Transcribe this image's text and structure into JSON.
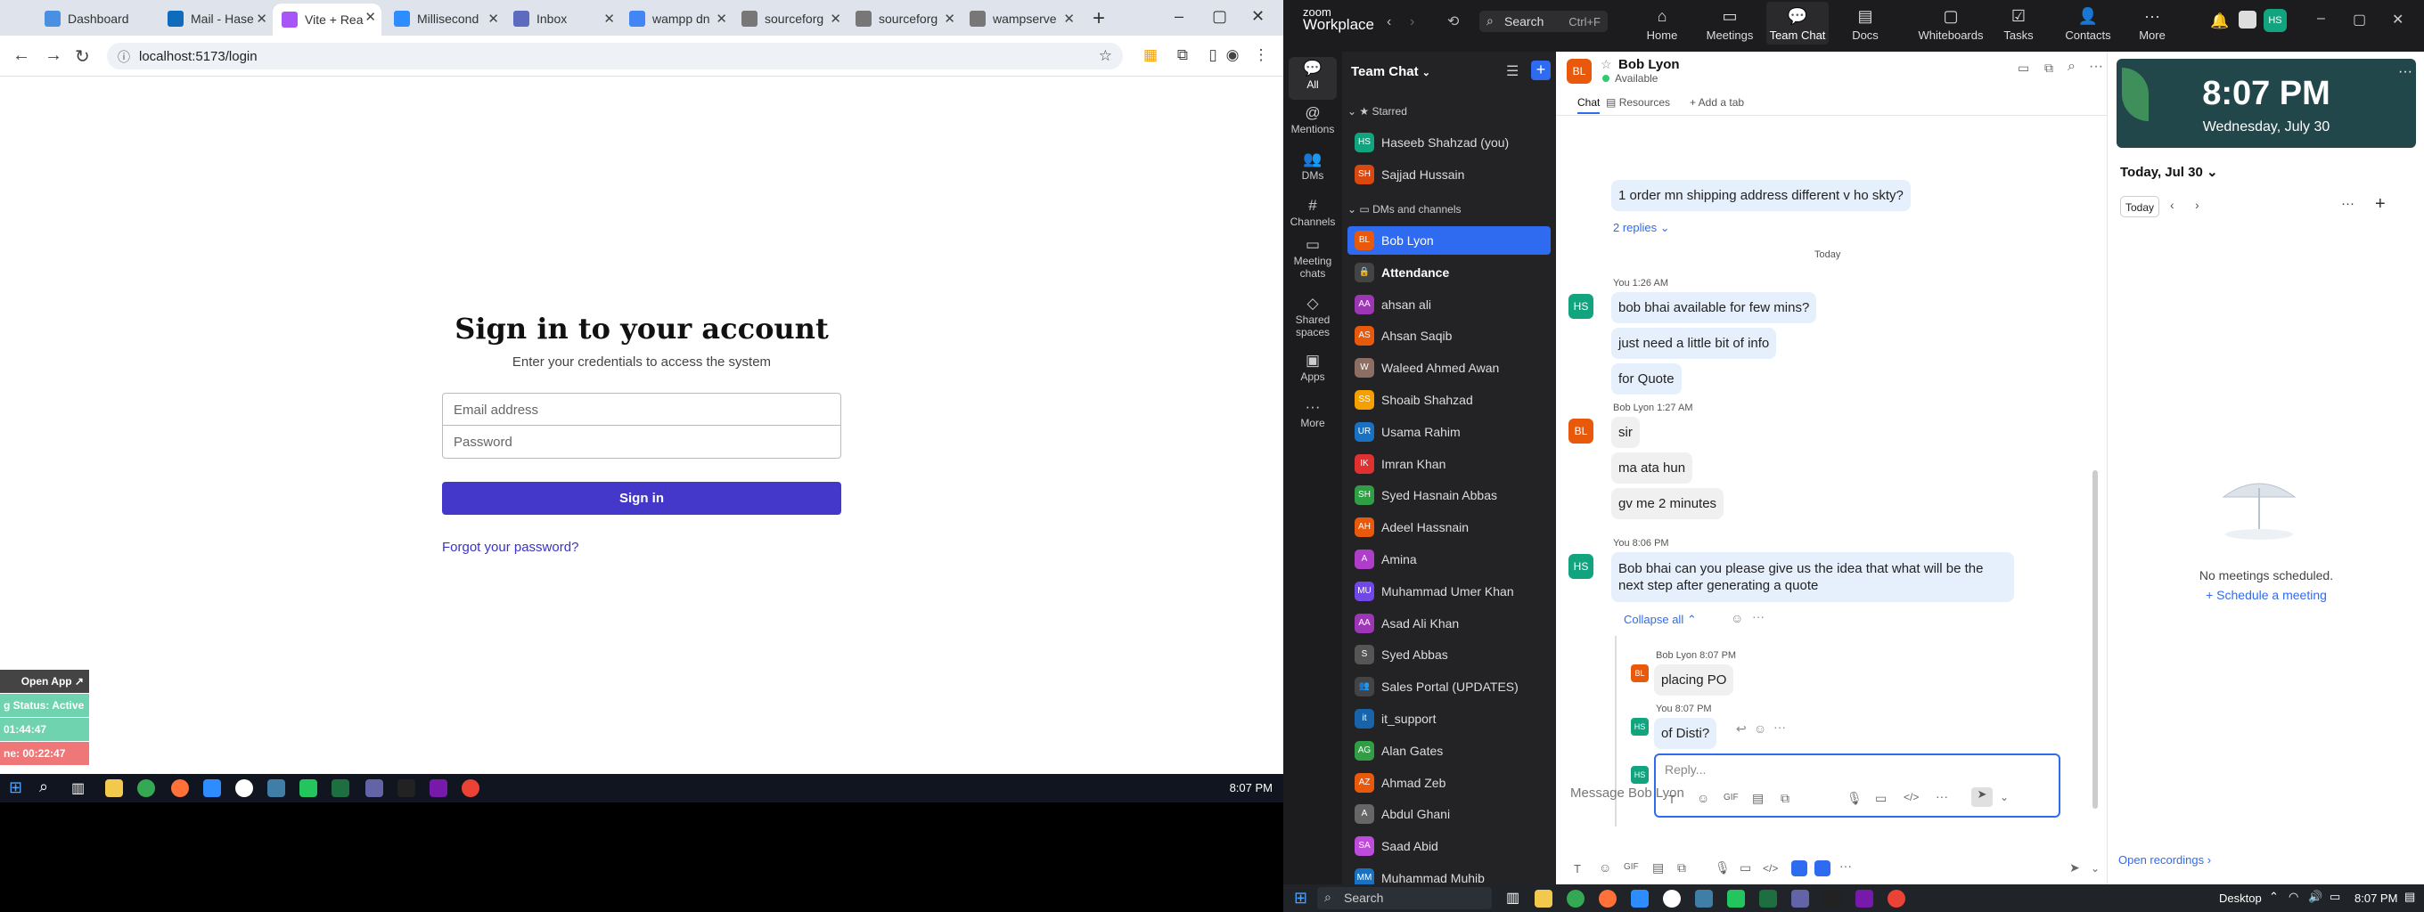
{
  "browser": {
    "tabs": [
      {
        "label": "Dashboard",
        "color": "#4a90e2"
      },
      {
        "label": "Mail - Hase",
        "color": "#0f6cbd"
      },
      {
        "label": "Vite + Rea",
        "color": "#a855f7",
        "active": true
      },
      {
        "label": "Millisecond",
        "color": "#2d8cff"
      },
      {
        "label": "Inbox",
        "color": "#5c6bc0"
      },
      {
        "label": "wampp dn",
        "color": "#4285f4"
      },
      {
        "label": "sourceforg",
        "color": "#777777"
      },
      {
        "label": "sourceforg",
        "color": "#777777"
      },
      {
        "label": "wampserve",
        "color": "#777777"
      }
    ],
    "url": "localhost:5173/login",
    "window_controls": {
      "minimize": "–",
      "maximize": "▢",
      "close": "✕"
    }
  },
  "login": {
    "title": "Sign in to your account",
    "subtitle": "Enter your credentials to access the system",
    "email_placeholder": "Email address",
    "password_placeholder": "Password",
    "submit_label": "Sign in",
    "forgot_label": "Forgot your password?"
  },
  "widget": {
    "open_app": "Open App ↗",
    "status": "g Status: Active",
    "timer1": "01:44:47",
    "timer2": "ne: 00:22:47"
  },
  "taskbar_left": {
    "time": "8:07 PM"
  },
  "zoom": {
    "logo_line1": "zoom",
    "logo_line2": "Workplace",
    "search_label": "Search",
    "search_shortcut": "Ctrl+F",
    "nav": [
      {
        "label": "Home",
        "icon": "⌂"
      },
      {
        "label": "Meetings",
        "icon": "▭"
      },
      {
        "label": "Team Chat",
        "icon": "💬",
        "active": true
      },
      {
        "label": "Docs",
        "icon": "▤"
      },
      {
        "label": "Whiteboards",
        "icon": "▢"
      },
      {
        "label": "Tasks",
        "icon": "☑"
      },
      {
        "label": "Contacts",
        "icon": "👤"
      },
      {
        "label": "More",
        "icon": "···"
      }
    ],
    "user_initials": "HS",
    "rail": [
      {
        "label": "All",
        "icon": "💬",
        "active": true
      },
      {
        "label": "Mentions",
        "icon": "@"
      },
      {
        "label": "DMs",
        "icon": "👥"
      },
      {
        "label": "Channels",
        "icon": "#"
      },
      {
        "label": "Meeting chats",
        "icon": "▭"
      },
      {
        "label": "Shared spaces",
        "icon": "◇"
      },
      {
        "label": "Apps",
        "icon": "▣"
      },
      {
        "label": "More",
        "icon": "···"
      }
    ],
    "list_title": "Team Chat",
    "starred_label": "Starred",
    "dms_label": "DMs and channels",
    "starred": [
      {
        "name": "Haseeb Shahzad (you)",
        "initials": "HS",
        "color": "#12a37f"
      },
      {
        "name": "Sajjad Hussain",
        "initials": "SH",
        "color": "#d9480f"
      }
    ],
    "channels": [
      {
        "name": "Bob Lyon",
        "initials": "BL",
        "color": "#e8590c",
        "selected": true
      },
      {
        "name": "Attendance",
        "initials": "🔒",
        "color": "#444444",
        "bold": true
      },
      {
        "name": "ahsan ali",
        "initials": "AA",
        "color": "#9c36b5"
      },
      {
        "name": "Ahsan Saqib",
        "initials": "AS",
        "color": "#e8590c"
      },
      {
        "name": "Waleed Ahmed Awan",
        "initials": "W",
        "color": "#8d6e63"
      },
      {
        "name": "Shoaib Shahzad",
        "initials": "SS",
        "color": "#f59f00"
      },
      {
        "name": "Usama Rahim",
        "initials": "UR",
        "color": "#1971c2"
      },
      {
        "name": "Imran Khan",
        "initials": "IK",
        "color": "#e03131"
      },
      {
        "name": "Syed Hasnain Abbas",
        "initials": "SH",
        "color": "#2f9e44"
      },
      {
        "name": "Adeel Hassnain",
        "initials": "AH",
        "color": "#e8590c"
      },
      {
        "name": "Amina",
        "initials": "A",
        "color": "#ae3ec9"
      },
      {
        "name": "Muhammad Umer Khan",
        "initials": "MU",
        "color": "#7048e8"
      },
      {
        "name": "Asad Ali Khan",
        "initials": "AA",
        "color": "#9c36b5"
      },
      {
        "name": "Syed Abbas",
        "initials": "S",
        "color": "#555555"
      },
      {
        "name": "Sales Portal (UPDATES)",
        "initials": "👥",
        "color": "#444444"
      },
      {
        "name": "it_support",
        "initials": "it",
        "color": "#1864ab"
      },
      {
        "name": "Alan Gates",
        "initials": "AG",
        "color": "#2f9e44"
      },
      {
        "name": "Ahmad Zeb",
        "initials": "AZ",
        "color": "#e8590c"
      },
      {
        "name": "Abdul Ghani",
        "initials": "A",
        "color": "#666666"
      },
      {
        "name": "Saad Abid",
        "initials": "SA",
        "color": "#be4bdb"
      },
      {
        "name": "Muhammad Muhib",
        "initials": "MM",
        "color": "#1971c2"
      }
    ],
    "chat": {
      "contact_name": "Bob Lyon",
      "contact_initials": "BL",
      "contact_status": "Available",
      "tabs": {
        "chat": "Chat",
        "resources": "Resources",
        "add": "+ Add a tab"
      },
      "msg_first": "1 order mn shipping address different v ho skty?",
      "replies": "2 replies",
      "day_divider": "Today",
      "you_1": "You 1:26 AM",
      "m1": "bob bhai available for few mins?",
      "m2": "just need a little bit of info",
      "m3": "for Quote",
      "bob_1": "Bob Lyon 1:27 AM",
      "m4": "sir",
      "m5": "ma ata hun",
      "m6": "gv me 2 minutes",
      "you_2": "You 8:06 PM",
      "m7": "Bob bhai can you please give us the idea that what will be the next step after generating a quote",
      "collapse": "Collapse all ⌃",
      "bob_2": "Bob Lyon 8:07 PM",
      "m8": "placing PO",
      "you_3": "You 8:07 PM",
      "m9": "of Disti?",
      "reply_placeholder": "Reply...",
      "message_placeholder": "Message Bob Lyon"
    },
    "calendar": {
      "time": "8:07 PM",
      "date": "Wednesday, July 30",
      "day_label": "Today, Jul 30 ⌄",
      "today_btn": "Today",
      "empty": "No meetings scheduled.",
      "schedule": "Schedule a meeting",
      "recordings": "Open recordings ›"
    }
  },
  "taskbar_right": {
    "search": "Search",
    "desktop": "Desktop",
    "time": "8:07 PM"
  }
}
